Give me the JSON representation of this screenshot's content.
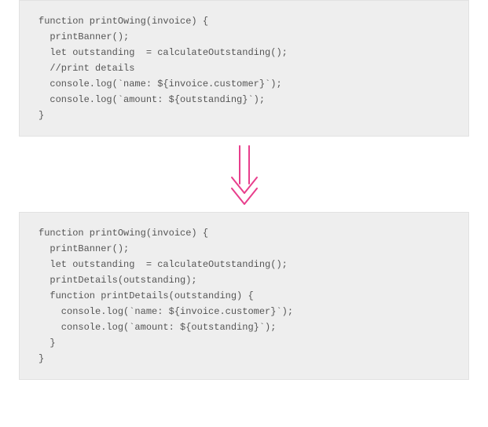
{
  "before": {
    "lines": [
      "function printOwing(invoice) {",
      "  printBanner();",
      "  let outstanding  = calculateOutstanding();",
      "",
      "  //print details",
      "  console.log(`name: ${invoice.customer}`);",
      "  console.log(`amount: ${outstanding}`);",
      "}"
    ]
  },
  "after": {
    "lines": [
      "function printOwing(invoice) {",
      "  printBanner();",
      "  let outstanding  = calculateOutstanding();",
      "  printDetails(outstanding);",
      "",
      "  function printDetails(outstanding) {",
      "    console.log(`name: ${invoice.customer}`);",
      "    console.log(`amount: ${outstanding}`);",
      "  }",
      "}"
    ]
  },
  "arrow": {
    "color": "#e83e8c",
    "semantic": "refactor-transform-arrow"
  }
}
